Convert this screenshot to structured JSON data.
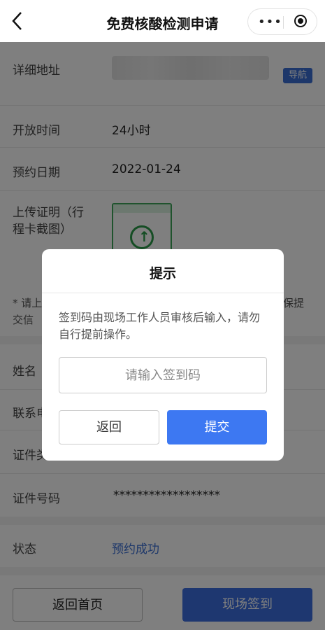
{
  "header": {
    "title": "免费核酸检测申请",
    "more_glyph": "•••"
  },
  "info": {
    "address_label": "详细地址",
    "navigate_label": "导航",
    "hours_label": "开放时间",
    "hours_value": "24小时",
    "date_label": "预约日期",
    "date_value": "2022-01-24",
    "upload_label": "上传证明（行程卡截图）",
    "note_partial_left": "请上",
    "note_partial_left2": "交信",
    "note_partial_right": "保提"
  },
  "person": {
    "name_label": "姓名",
    "phone_label": "联系电",
    "idtype_label": "证件类",
    "idno_label": "证件号码",
    "idno_value": "******************"
  },
  "status": {
    "label": "状态",
    "value": "预约成功"
  },
  "footer": {
    "home_label": "返回首页",
    "sign_label": "现场签到"
  },
  "dialog": {
    "title": "提示",
    "message": "签到码由现场工作人员审核后输入，请勿自行提前操作。",
    "input_placeholder": "请输入签到码",
    "input_value": "",
    "cancel_label": "返回",
    "submit_label": "提交"
  },
  "colors": {
    "accent": "#3d78f2",
    "status_link": "#3b6fd4",
    "required_star": "#dd3333"
  }
}
